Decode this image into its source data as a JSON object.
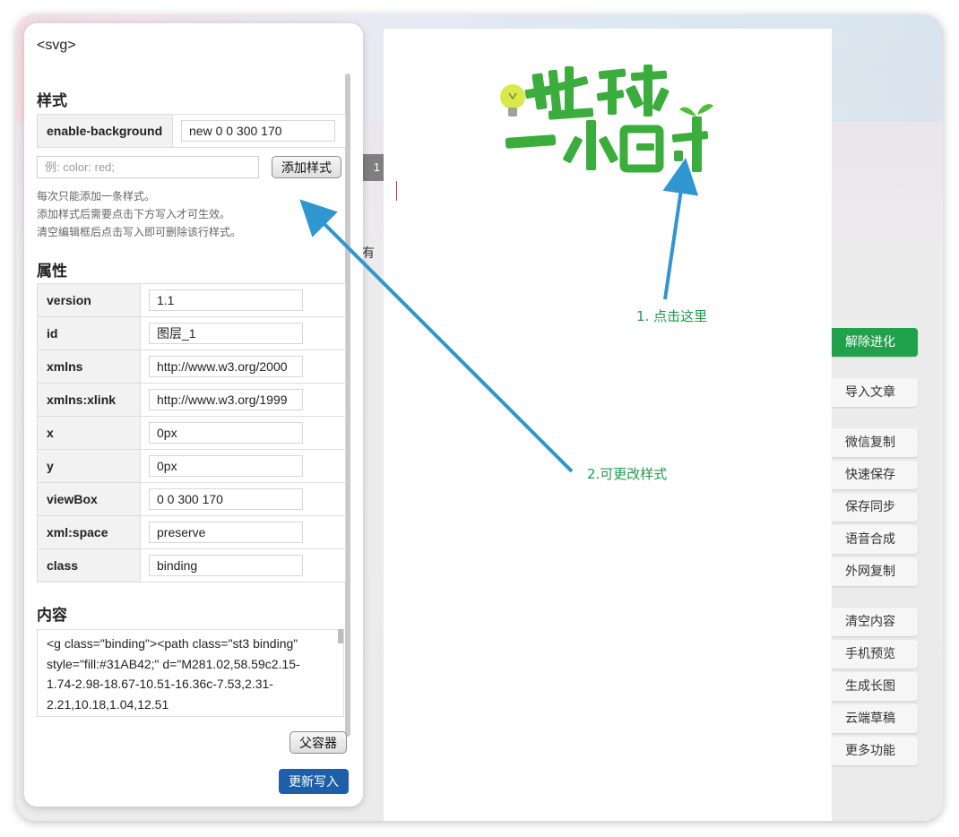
{
  "colors": {
    "accent_green": "#20a14b",
    "arrow_blue": "#2f96d0",
    "primary_blue": "#1f5fa8",
    "hint_green": "#1f9a4a"
  },
  "panel": {
    "tag": "<svg>",
    "style_section": {
      "title": "样式",
      "rows": [
        {
          "key": "enable-background",
          "value": "new 0 0 300 170"
        }
      ],
      "input_placeholder": "例: color: red;",
      "add_button": "添加样式",
      "notes": [
        "每次只能添加一条样式。",
        "添加样式后需要点击下方写入才可生效。",
        "清空编辑框后点击写入即可删除该行样式。"
      ]
    },
    "attr_section": {
      "title": "属性",
      "rows": [
        {
          "key": "version",
          "value": "1.1"
        },
        {
          "key": "id",
          "value": "图层_1"
        },
        {
          "key": "xmlns",
          "value": "http://www.w3.org/2000"
        },
        {
          "key": "xmlns:xlink",
          "value": "http://www.w3.org/1999"
        },
        {
          "key": "x",
          "value": "0px"
        },
        {
          "key": "y",
          "value": "0px"
        },
        {
          "key": "viewBox",
          "value": "0 0 300 170"
        },
        {
          "key": "xml:space",
          "value": "preserve"
        },
        {
          "key": "class",
          "value": "binding"
        }
      ]
    },
    "content_section": {
      "title": "内容",
      "lines": [
        "<g class=\"binding\"><path class=\"st3 binding\"",
        "style=\"fill:#31AB42;\" d=\"M281.02,58.59c2.15-",
        "1.74-2.98-18.67-10.51-16.36c-7.53,2.31-",
        "2.21,10.18,1.04,12.51"
      ]
    },
    "parent_button": "父容器",
    "update_button": "更新写入"
  },
  "background": {
    "tab_number": "1",
    "text_fragment": "有"
  },
  "editor": {
    "logo_text": "地球一小时",
    "hint1": "1. 点击这里",
    "hint2": "2.可更改样式"
  },
  "toolbar": {
    "buttons": [
      {
        "label": "解除进化",
        "primary": true
      },
      {
        "label": "导入文章"
      },
      {
        "label": "微信复制"
      },
      {
        "label": "快速保存"
      },
      {
        "label": "保存同步"
      },
      {
        "label": "语音合成"
      },
      {
        "label": "外网复制"
      },
      {
        "label": "清空内容"
      },
      {
        "label": "手机预览"
      },
      {
        "label": "生成长图"
      },
      {
        "label": "云端草稿"
      },
      {
        "label": "更多功能"
      }
    ]
  }
}
